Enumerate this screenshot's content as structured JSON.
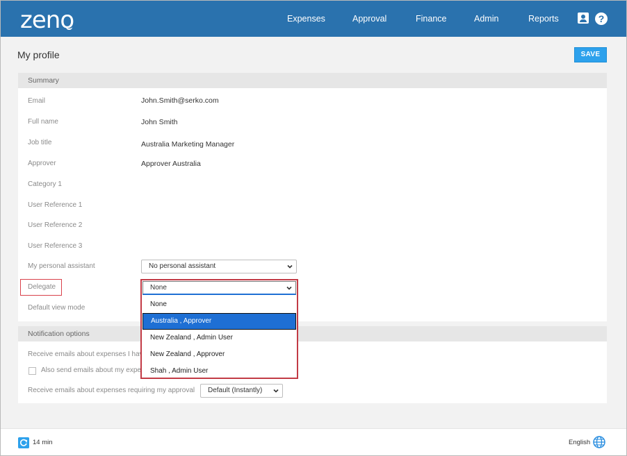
{
  "header": {
    "logo": "zeno",
    "nav": [
      "Expenses",
      "Approval",
      "Finance",
      "Admin",
      "Reports"
    ],
    "help_glyph": "?"
  },
  "page": {
    "title": "My profile",
    "save_label": "SAVE"
  },
  "summary": {
    "heading": "Summary",
    "fields": [
      {
        "label": "Email",
        "value": "John.Smith@serko.com"
      },
      {
        "label": "Full name",
        "value": "John Smith"
      },
      {
        "label": "Job title",
        "value": "Australia Marketing Manager"
      },
      {
        "label": "Approver",
        "value": "Approver Australia"
      },
      {
        "label": "Category 1",
        "value": ""
      },
      {
        "label": "User Reference 1",
        "value": ""
      },
      {
        "label": "User Reference 2",
        "value": ""
      },
      {
        "label": "User Reference 3",
        "value": ""
      }
    ],
    "assistant": {
      "label": "My personal assistant",
      "selected": "No personal assistant"
    },
    "delegate": {
      "label": "Delegate",
      "selected": "None",
      "options": [
        "None",
        "Australia , Approver",
        "New Zealand , Admin User",
        "New Zealand , Approver",
        "Shah , Admin User"
      ],
      "highlighted_index": 1
    },
    "view_mode": {
      "label": "Default view mode"
    }
  },
  "notifications": {
    "heading": "Notification options",
    "line1": "Receive emails about expenses I hav",
    "line2": "Also send emails about my expe",
    "line3": "Receive emails about expenses requiring my approval",
    "approval_selected": "Default (Instantly)"
  },
  "footer": {
    "refresh": "14 min",
    "language": "English"
  },
  "colors": {
    "brand": "#2a72ae",
    "accent": "#2da1ec",
    "highlight": "#1e6fd4",
    "callout": "#d9404a"
  },
  "icons": [
    "user-icon",
    "help-icon",
    "chevron-down-icon",
    "refresh-icon",
    "globe-icon"
  ]
}
